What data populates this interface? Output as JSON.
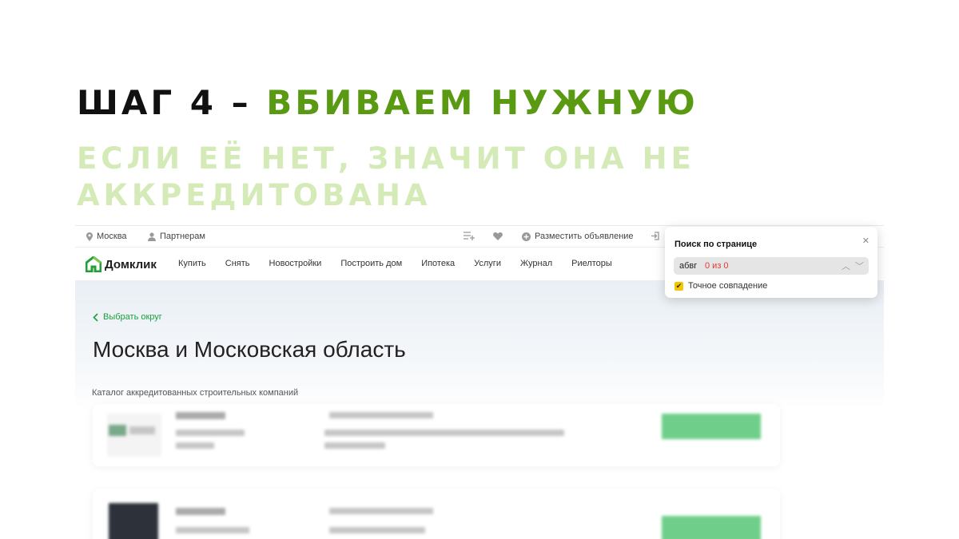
{
  "slide": {
    "headline_prefix": "ШАГ 4 – ",
    "headline_highlight": "ВБИВАЕМ НУЖНУЮ",
    "subheadline": "ЕСЛИ ЕЁ НЕТ, ЗНАЧИТ ОНА НЕ АККРЕДИТОВАНА"
  },
  "topbar": {
    "city": "Москва",
    "partners": "Партнерам",
    "post_ad": "Разместить объявление"
  },
  "navbar": {
    "logo": "Домклик",
    "items": [
      "Купить",
      "Снять",
      "Новостройки",
      "Построить дом",
      "Ипотека",
      "Услуги",
      "Журнал",
      "Риелторы"
    ]
  },
  "page": {
    "back_link": "Выбрать округ",
    "title": "Москва и Московская область",
    "catalog_label": "Каталог аккредитованных строительных компаний"
  },
  "find_popup": {
    "title": "Поиск по странице",
    "query": "абвг",
    "match_count": "0 из 0",
    "exact_match_label": "Точное совпадение",
    "exact_match_checked": true
  },
  "colors": {
    "accent_green": "#5a9a12",
    "light_green": "#d4ebb8",
    "domclick_green": "#1b9e3e",
    "checkbox_yellow": "#f5c500",
    "error_red": "#e53935"
  },
  "icons": {
    "location": "location-pin-icon",
    "user": "user-icon",
    "compare": "compare-icon",
    "favorite": "heart-icon",
    "add": "plus-circle-icon",
    "login": "login-icon",
    "back": "chevron-left-icon",
    "close": "close-icon",
    "up": "chevron-up-icon",
    "down": "chevron-down-icon",
    "check": "checkmark-icon"
  }
}
